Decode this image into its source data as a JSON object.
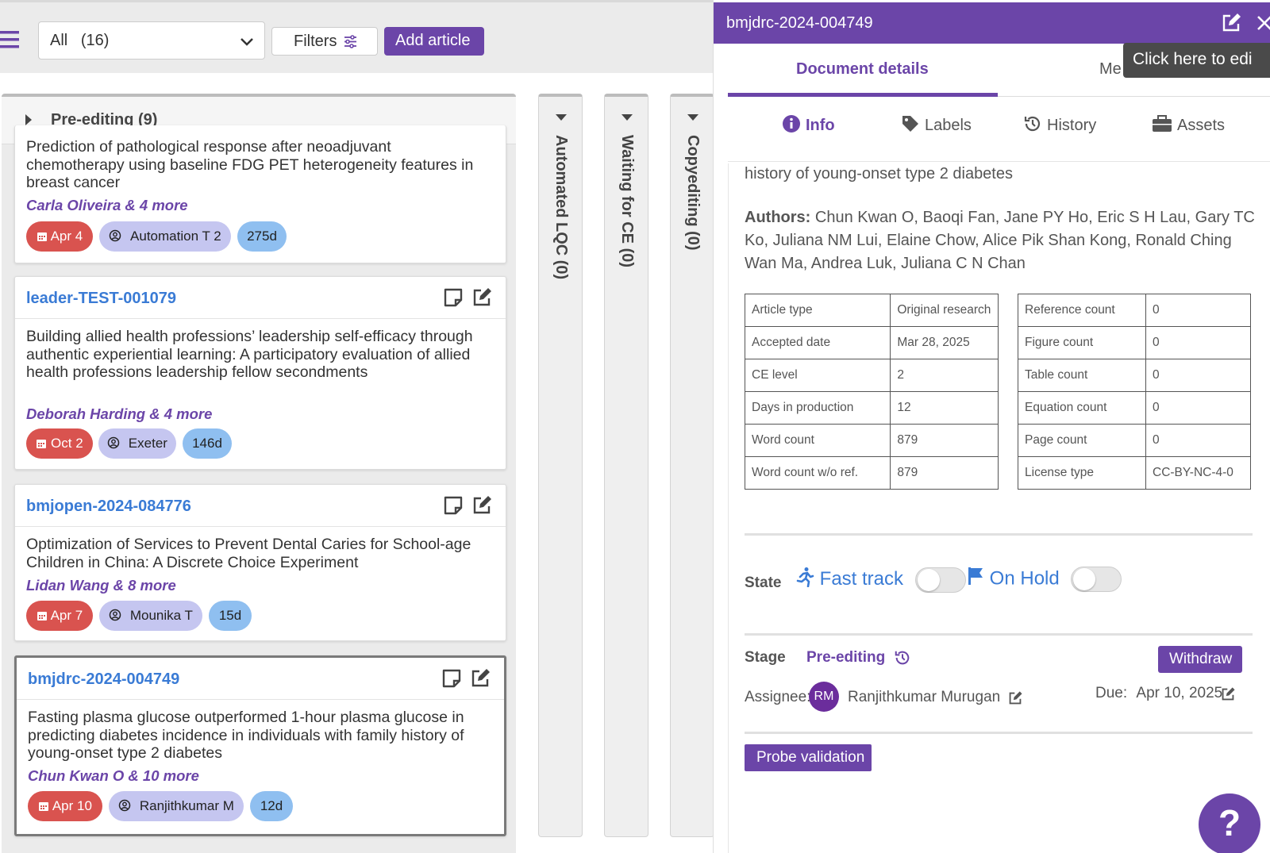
{
  "toolbar": {
    "view_select_value": "All   (16)",
    "filters_label": "Filters",
    "add_article_label": "Add article"
  },
  "column": {
    "title": "Pre-editing (9)",
    "cards": [
      {
        "title": "Prediction of pathological response after neoadjuvant chemotherapy using baseline FDG PET heterogeneity features in breast cancer",
        "authors": "Carla Oliveira & 4 more",
        "date": "Apr 4",
        "user": "Automation T 2",
        "days": "275d"
      },
      {
        "id": "leader-TEST-001079",
        "title": "Building allied health professions’ leadership self-efficacy through authentic experiential learning: A participatory evaluation of allied health professions leadership fellow secondments",
        "authors": "Deborah Harding & 4 more",
        "date": "Oct 2",
        "user": "Exeter",
        "days": "146d"
      },
      {
        "id": "bmjopen-2024-084776",
        "title": "Optimization of Services to Prevent Dental Caries for School-age Children in China: A Discrete Choice Experiment",
        "authors": "Lidan Wang & 8 more",
        "date": "Apr 7",
        "user": "Mounika T",
        "days": "15d"
      },
      {
        "id": "bmjdrc-2024-004749",
        "title": "Fasting plasma glucose outperformed 1-hour plasma glucose in predicting diabetes incidence in individuals with family history of young-onset type 2 diabetes",
        "authors": "Chun Kwan O & 10 more",
        "date": "Apr 10",
        "user": "Ranjithkumar M",
        "days": "12d"
      }
    ]
  },
  "collapsed_columns": [
    "Automated LQC (0)",
    "Waiting for CE (0)",
    "Copyediting (0)"
  ],
  "panel": {
    "article_id": "bmjdrc-2024-004749",
    "tooltip": "Click here to edi",
    "tabs": {
      "active": "Document details",
      "other": "Me"
    },
    "subtabs": {
      "info": "Info",
      "labels": "Labels",
      "history": "History",
      "assets": "Assets"
    },
    "title_tail": "history of young-onset type 2 diabetes",
    "authors_label": "Authors:",
    "authors": "Chun Kwan O, Baoqi Fan, Jane PY Ho, Eric S H Lau, Gary TC Ko, Juliana NM Lui, Elaine Chow, Alice Pik Shan Kong, Ronald Ching Wan Ma, Andrea Luk, Juliana C N Chan",
    "table_left": [
      {
        "label": "Article type",
        "value": "Original research"
      },
      {
        "label": "Accepted date",
        "value": "Mar 28, 2025"
      },
      {
        "label": "CE level",
        "value": "2"
      },
      {
        "label": "Days in production",
        "value": "12"
      },
      {
        "label": "Word count",
        "value": "879"
      },
      {
        "label": "Word count w/o ref.",
        "value": "879"
      }
    ],
    "table_right": [
      {
        "label": "Reference count",
        "value": "0"
      },
      {
        "label": "Figure count",
        "value": "0"
      },
      {
        "label": "Table count",
        "value": "0"
      },
      {
        "label": "Equation count",
        "value": "0"
      },
      {
        "label": "Page count",
        "value": "0"
      },
      {
        "label": "License type",
        "value": "CC-BY-NC-4-0"
      }
    ],
    "state_label": "State",
    "fast_track_label": "Fast track",
    "on_hold_label": "On Hold",
    "stage_label": "Stage",
    "stage_value": "Pre-editing",
    "withdraw_label": "Withdraw",
    "assignee_label": "Assignee:",
    "assignee_initials": "RM",
    "assignee_name": "Ranjithkumar Murugan",
    "due_label": "Due:",
    "due_value": "Apr 10, 2025",
    "probe_label": "Probe validation",
    "help_label": "?"
  },
  "colors": {
    "accent": "#6b45a8",
    "link": "#3a7bd5",
    "date_chip": "#d9534f",
    "user_chip": "#c5c6f0",
    "days_chip": "#8fbff0"
  }
}
